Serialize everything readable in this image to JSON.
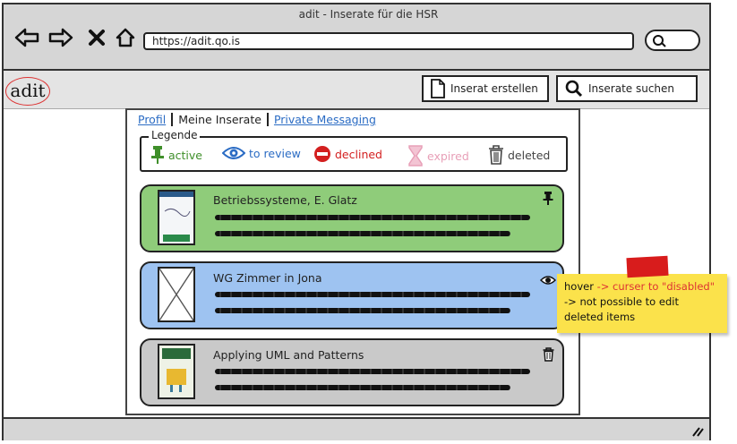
{
  "window": {
    "title": "adit - Inserate für die HSR"
  },
  "browser": {
    "url": "https://adit.qo.is"
  },
  "app": {
    "logo": "adit",
    "create_label": "Inserat erstellen",
    "search_label": "Inserate suchen"
  },
  "tabs": [
    {
      "label": "Profil"
    },
    {
      "label": "Meine Inserate"
    },
    {
      "label": "Private Messaging"
    }
  ],
  "legend": {
    "title": "Legende",
    "items": [
      {
        "label": "active",
        "icon": "pin-icon",
        "color": "#3f8f2a"
      },
      {
        "label": "to review",
        "icon": "eye-icon",
        "color": "#2b6cc4"
      },
      {
        "label": "declined",
        "icon": "no-entry-icon",
        "color": "#d31f1f"
      },
      {
        "label": "expired",
        "icon": "hourglass-icon",
        "color": "#e8a0b8"
      },
      {
        "label": "deleted",
        "icon": "trash-icon",
        "color": "#444444"
      }
    ]
  },
  "listings": [
    {
      "title": "Betriebssysteme, E. Glatz",
      "status": "active",
      "bg": "#8fcc7a",
      "status_icon": "pin-icon"
    },
    {
      "title": "WG Zimmer in Jona",
      "status": "to review",
      "bg": "#9ec3f1",
      "status_icon": "eye-icon"
    },
    {
      "title": "Applying UML and Patterns",
      "status": "deleted",
      "bg": "#c9c9c9",
      "status_icon": "trash-icon"
    }
  ],
  "note": {
    "line1_a": "hover",
    "line1_b": " -> curser to \"disabled\"",
    "line2": "-> not possible to edit",
    "line3": "deleted items"
  }
}
